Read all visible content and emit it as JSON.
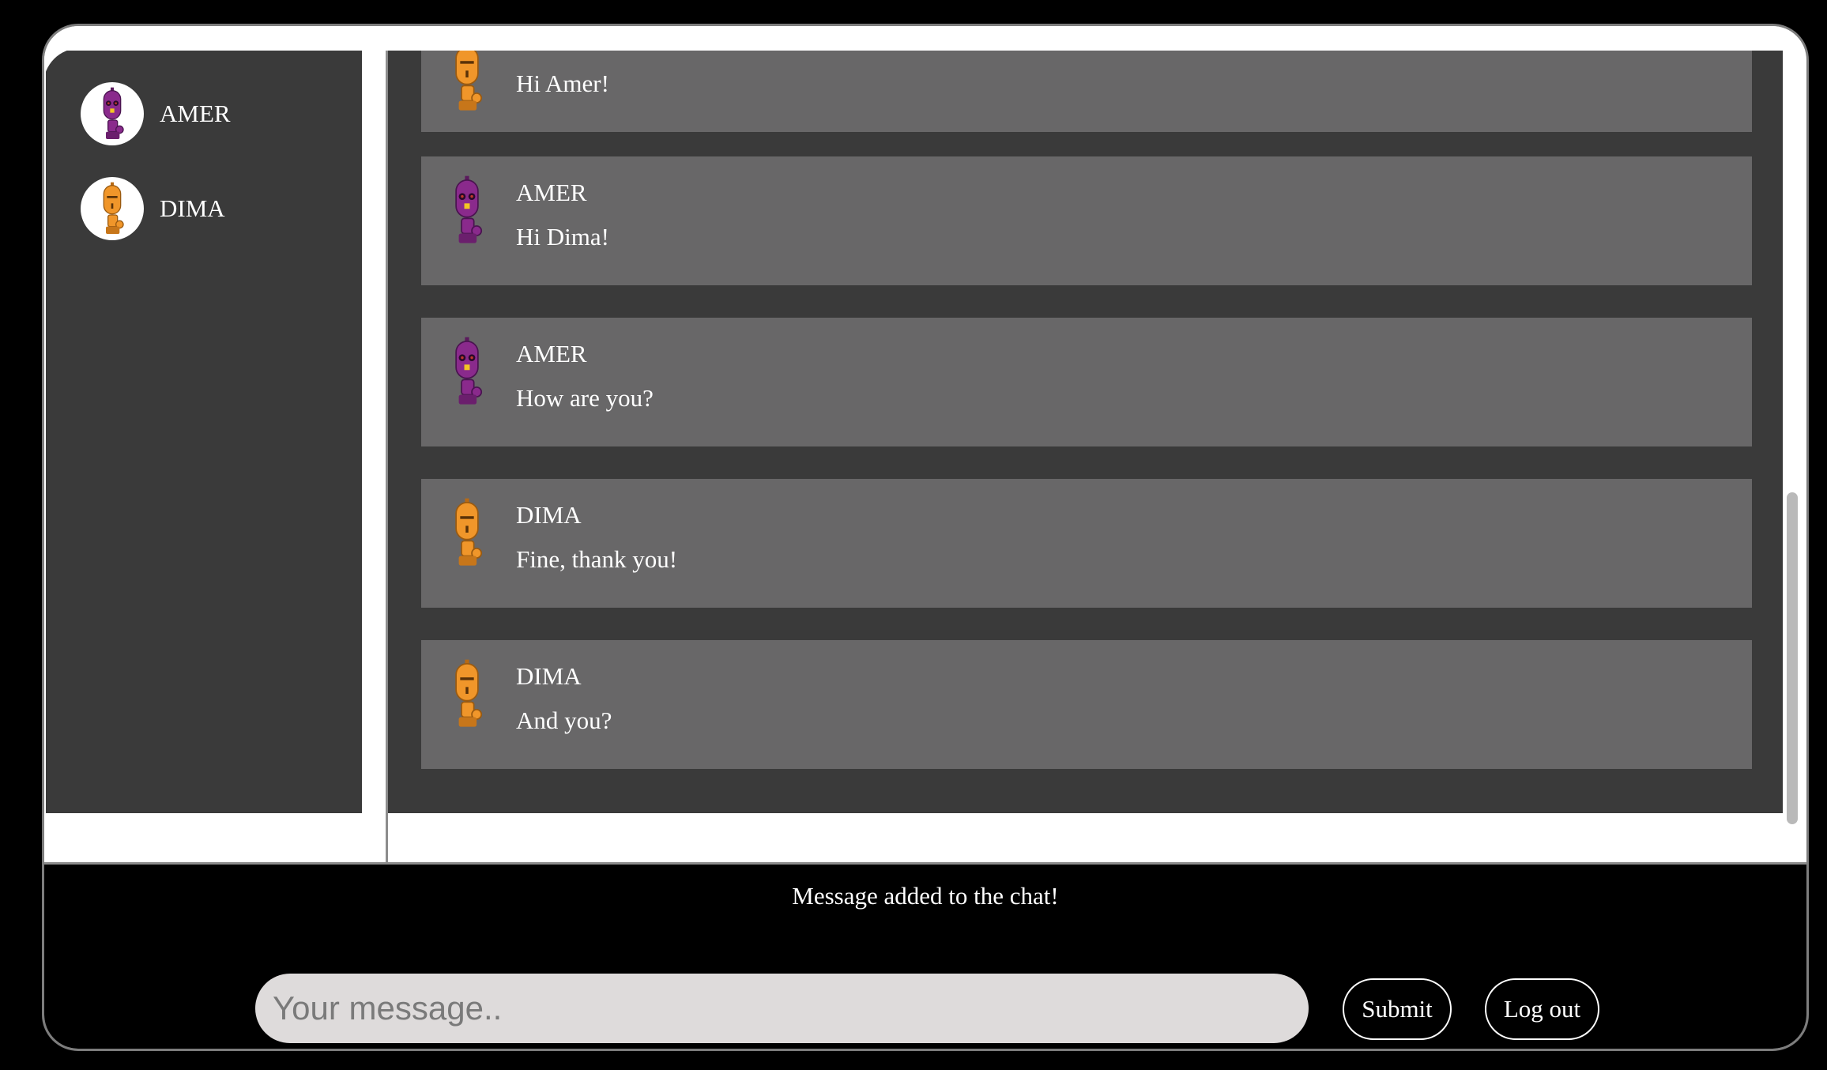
{
  "users": [
    {
      "name": "AMER",
      "icon": "purple-robot-icon",
      "color": "#8a2a8c"
    },
    {
      "name": "DIMA",
      "icon": "orange-robot-icon",
      "color": "#f0962a"
    }
  ],
  "messages": [
    {
      "author": "",
      "text": "Hi Amer!",
      "icon": "orange-robot-icon"
    },
    {
      "author": "AMER",
      "text": "Hi Dima!",
      "icon": "purple-robot-icon"
    },
    {
      "author": "AMER",
      "text": "How are you?",
      "icon": "purple-robot-icon"
    },
    {
      "author": "DIMA",
      "text": "Fine, thank you!",
      "icon": "orange-robot-icon"
    },
    {
      "author": "DIMA",
      "text": "And you?",
      "icon": "orange-robot-icon"
    }
  ],
  "status_message": "Message added to the chat!",
  "composer": {
    "placeholder": "Your message..",
    "submit_label": "Submit",
    "logout_label": "Log out"
  },
  "colors": {
    "panel": "#3a3a3a",
    "message_bg": "#686768",
    "input_bg": "#dedbdb"
  }
}
